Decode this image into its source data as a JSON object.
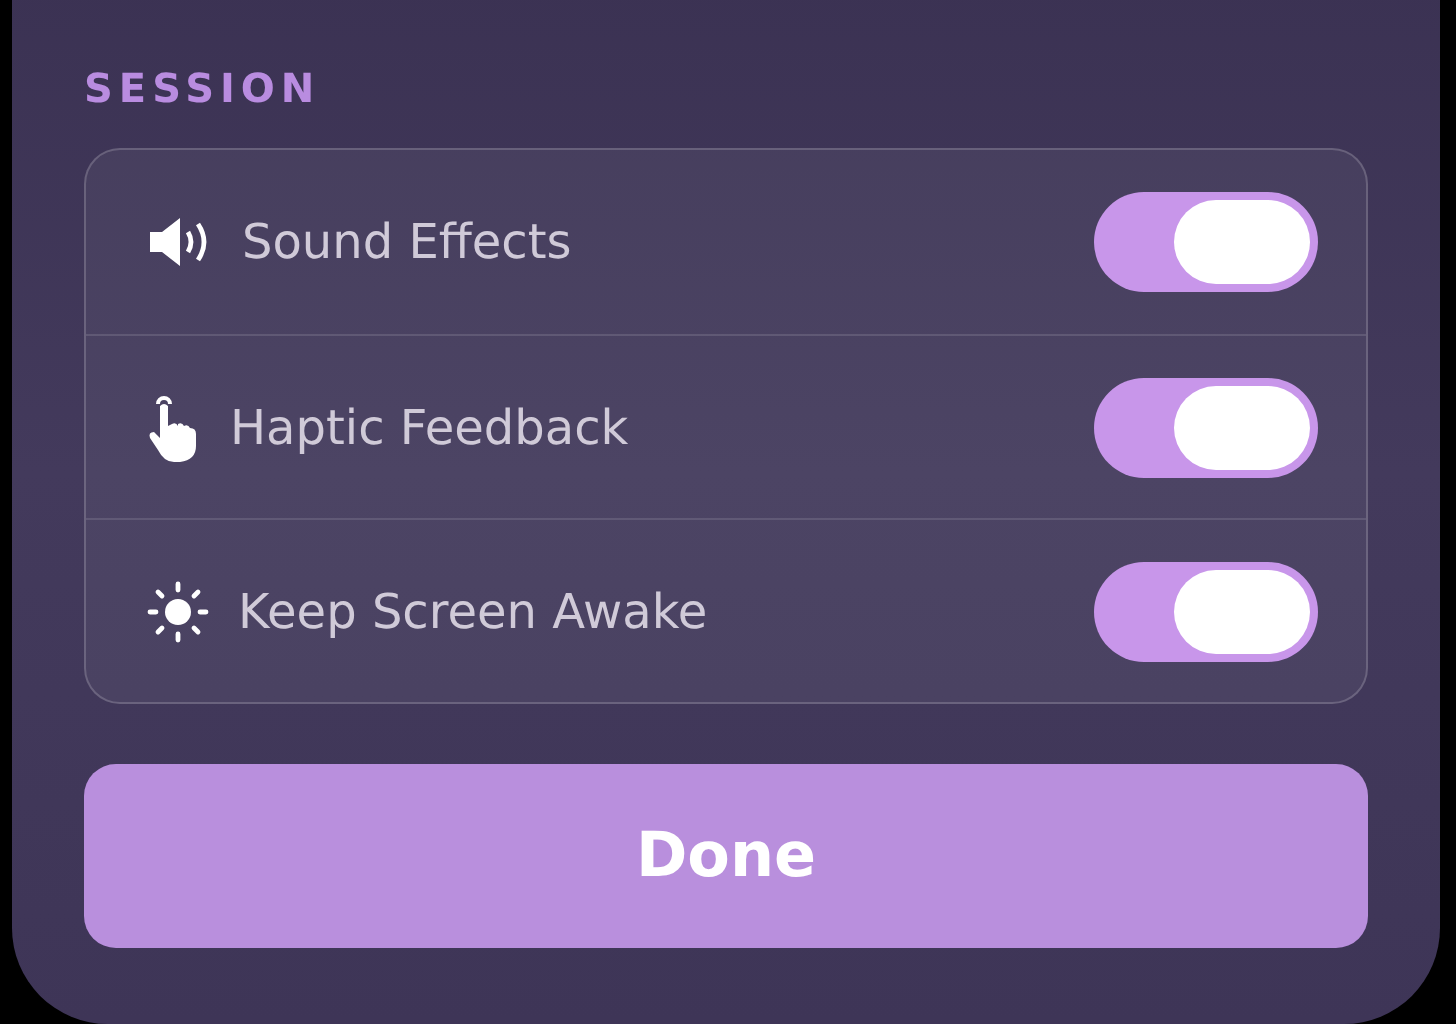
{
  "section": {
    "title": "SESSION"
  },
  "settings": [
    {
      "label": "Sound Effects",
      "on": true
    },
    {
      "label": "Haptic Feedback",
      "on": true
    },
    {
      "label": "Keep Screen Awake",
      "on": true
    }
  ],
  "done_button": {
    "label": "Done"
  }
}
